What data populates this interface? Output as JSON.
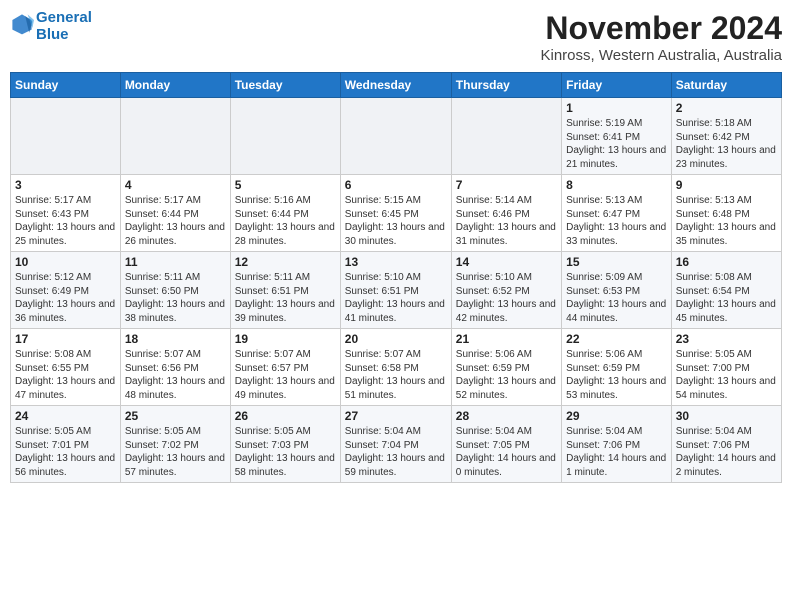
{
  "app": {
    "logo_line1": "General",
    "logo_line2": "Blue"
  },
  "title": "November 2024",
  "subtitle": "Kinross, Western Australia, Australia",
  "weekdays": [
    "Sunday",
    "Monday",
    "Tuesday",
    "Wednesday",
    "Thursday",
    "Friday",
    "Saturday"
  ],
  "weeks": [
    [
      {
        "day": "",
        "info": ""
      },
      {
        "day": "",
        "info": ""
      },
      {
        "day": "",
        "info": ""
      },
      {
        "day": "",
        "info": ""
      },
      {
        "day": "",
        "info": ""
      },
      {
        "day": "1",
        "info": "Sunrise: 5:19 AM\nSunset: 6:41 PM\nDaylight: 13 hours\nand 21 minutes."
      },
      {
        "day": "2",
        "info": "Sunrise: 5:18 AM\nSunset: 6:42 PM\nDaylight: 13 hours\nand 23 minutes."
      }
    ],
    [
      {
        "day": "3",
        "info": "Sunrise: 5:17 AM\nSunset: 6:43 PM\nDaylight: 13 hours\nand 25 minutes."
      },
      {
        "day": "4",
        "info": "Sunrise: 5:17 AM\nSunset: 6:44 PM\nDaylight: 13 hours\nand 26 minutes."
      },
      {
        "day": "5",
        "info": "Sunrise: 5:16 AM\nSunset: 6:44 PM\nDaylight: 13 hours\nand 28 minutes."
      },
      {
        "day": "6",
        "info": "Sunrise: 5:15 AM\nSunset: 6:45 PM\nDaylight: 13 hours\nand 30 minutes."
      },
      {
        "day": "7",
        "info": "Sunrise: 5:14 AM\nSunset: 6:46 PM\nDaylight: 13 hours\nand 31 minutes."
      },
      {
        "day": "8",
        "info": "Sunrise: 5:13 AM\nSunset: 6:47 PM\nDaylight: 13 hours\nand 33 minutes."
      },
      {
        "day": "9",
        "info": "Sunrise: 5:13 AM\nSunset: 6:48 PM\nDaylight: 13 hours\nand 35 minutes."
      }
    ],
    [
      {
        "day": "10",
        "info": "Sunrise: 5:12 AM\nSunset: 6:49 PM\nDaylight: 13 hours\nand 36 minutes."
      },
      {
        "day": "11",
        "info": "Sunrise: 5:11 AM\nSunset: 6:50 PM\nDaylight: 13 hours\nand 38 minutes."
      },
      {
        "day": "12",
        "info": "Sunrise: 5:11 AM\nSunset: 6:51 PM\nDaylight: 13 hours\nand 39 minutes."
      },
      {
        "day": "13",
        "info": "Sunrise: 5:10 AM\nSunset: 6:51 PM\nDaylight: 13 hours\nand 41 minutes."
      },
      {
        "day": "14",
        "info": "Sunrise: 5:10 AM\nSunset: 6:52 PM\nDaylight: 13 hours\nand 42 minutes."
      },
      {
        "day": "15",
        "info": "Sunrise: 5:09 AM\nSunset: 6:53 PM\nDaylight: 13 hours\nand 44 minutes."
      },
      {
        "day": "16",
        "info": "Sunrise: 5:08 AM\nSunset: 6:54 PM\nDaylight: 13 hours\nand 45 minutes."
      }
    ],
    [
      {
        "day": "17",
        "info": "Sunrise: 5:08 AM\nSunset: 6:55 PM\nDaylight: 13 hours\nand 47 minutes."
      },
      {
        "day": "18",
        "info": "Sunrise: 5:07 AM\nSunset: 6:56 PM\nDaylight: 13 hours\nand 48 minutes."
      },
      {
        "day": "19",
        "info": "Sunrise: 5:07 AM\nSunset: 6:57 PM\nDaylight: 13 hours\nand 49 minutes."
      },
      {
        "day": "20",
        "info": "Sunrise: 5:07 AM\nSunset: 6:58 PM\nDaylight: 13 hours\nand 51 minutes."
      },
      {
        "day": "21",
        "info": "Sunrise: 5:06 AM\nSunset: 6:59 PM\nDaylight: 13 hours\nand 52 minutes."
      },
      {
        "day": "22",
        "info": "Sunrise: 5:06 AM\nSunset: 6:59 PM\nDaylight: 13 hours\nand 53 minutes."
      },
      {
        "day": "23",
        "info": "Sunrise: 5:05 AM\nSunset: 7:00 PM\nDaylight: 13 hours\nand 54 minutes."
      }
    ],
    [
      {
        "day": "24",
        "info": "Sunrise: 5:05 AM\nSunset: 7:01 PM\nDaylight: 13 hours\nand 56 minutes."
      },
      {
        "day": "25",
        "info": "Sunrise: 5:05 AM\nSunset: 7:02 PM\nDaylight: 13 hours\nand 57 minutes."
      },
      {
        "day": "26",
        "info": "Sunrise: 5:05 AM\nSunset: 7:03 PM\nDaylight: 13 hours\nand 58 minutes."
      },
      {
        "day": "27",
        "info": "Sunrise: 5:04 AM\nSunset: 7:04 PM\nDaylight: 13 hours\nand 59 minutes."
      },
      {
        "day": "28",
        "info": "Sunrise: 5:04 AM\nSunset: 7:05 PM\nDaylight: 14 hours\nand 0 minutes."
      },
      {
        "day": "29",
        "info": "Sunrise: 5:04 AM\nSunset: 7:06 PM\nDaylight: 14 hours\nand 1 minute."
      },
      {
        "day": "30",
        "info": "Sunrise: 5:04 AM\nSunset: 7:06 PM\nDaylight: 14 hours\nand 2 minutes."
      }
    ]
  ]
}
